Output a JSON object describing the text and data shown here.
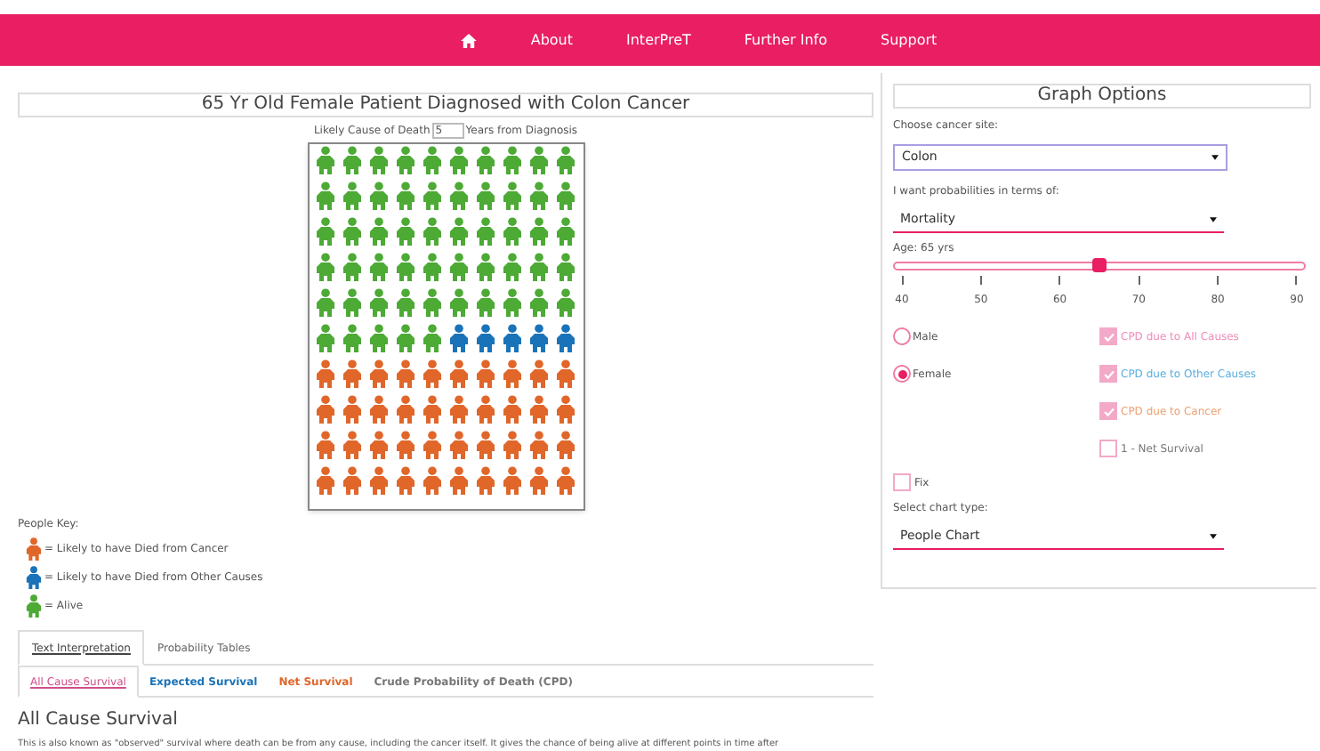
{
  "nav": {
    "items": [
      {
        "kind": "home"
      },
      {
        "label": "About"
      },
      {
        "label": "InterPreT"
      },
      {
        "label": "Further Info"
      },
      {
        "label": "Support"
      }
    ]
  },
  "title": "65 Yr Old Female Patient Diagnosed with Colon Cancer",
  "years_control": {
    "prefix": "Likely Cause of Death",
    "value": "5",
    "suffix": "Years from Diagnosis"
  },
  "people_chart": {
    "rows": [
      [
        {
          "kind": "alive"
        },
        {
          "kind": "alive"
        },
        {
          "kind": "alive"
        },
        {
          "kind": "alive"
        },
        {
          "kind": "alive"
        },
        {
          "kind": "alive"
        },
        {
          "kind": "alive"
        },
        {
          "kind": "alive"
        },
        {
          "kind": "alive"
        },
        {
          "kind": "alive"
        }
      ],
      [
        {
          "kind": "alive"
        },
        {
          "kind": "alive"
        },
        {
          "kind": "alive"
        },
        {
          "kind": "alive"
        },
        {
          "kind": "alive"
        },
        {
          "kind": "alive"
        },
        {
          "kind": "alive"
        },
        {
          "kind": "alive"
        },
        {
          "kind": "alive"
        },
        {
          "kind": "alive"
        }
      ],
      [
        {
          "kind": "alive"
        },
        {
          "kind": "alive"
        },
        {
          "kind": "alive"
        },
        {
          "kind": "alive"
        },
        {
          "kind": "alive"
        },
        {
          "kind": "alive"
        },
        {
          "kind": "alive"
        },
        {
          "kind": "alive"
        },
        {
          "kind": "alive"
        },
        {
          "kind": "alive"
        }
      ],
      [
        {
          "kind": "alive"
        },
        {
          "kind": "alive"
        },
        {
          "kind": "alive"
        },
        {
          "kind": "alive"
        },
        {
          "kind": "alive"
        },
        {
          "kind": "alive"
        },
        {
          "kind": "alive"
        },
        {
          "kind": "alive"
        },
        {
          "kind": "alive"
        },
        {
          "kind": "alive"
        }
      ],
      [
        {
          "kind": "alive"
        },
        {
          "kind": "alive"
        },
        {
          "kind": "alive"
        },
        {
          "kind": "alive"
        },
        {
          "kind": "alive"
        },
        {
          "kind": "alive"
        },
        {
          "kind": "alive"
        },
        {
          "kind": "alive"
        },
        {
          "kind": "alive"
        },
        {
          "kind": "alive"
        }
      ],
      [
        {
          "kind": "alive"
        },
        {
          "kind": "alive"
        },
        {
          "kind": "alive"
        },
        {
          "kind": "alive"
        },
        {
          "kind": "alive"
        },
        {
          "kind": "other"
        },
        {
          "kind": "other"
        },
        {
          "kind": "other"
        },
        {
          "kind": "other"
        },
        {
          "kind": "other"
        }
      ],
      [
        {
          "kind": "cancer"
        },
        {
          "kind": "cancer"
        },
        {
          "kind": "cancer"
        },
        {
          "kind": "cancer"
        },
        {
          "kind": "cancer"
        },
        {
          "kind": "cancer"
        },
        {
          "kind": "cancer"
        },
        {
          "kind": "cancer"
        },
        {
          "kind": "cancer"
        },
        {
          "kind": "cancer"
        }
      ],
      [
        {
          "kind": "cancer"
        },
        {
          "kind": "cancer"
        },
        {
          "kind": "cancer"
        },
        {
          "kind": "cancer"
        },
        {
          "kind": "cancer"
        },
        {
          "kind": "cancer"
        },
        {
          "kind": "cancer"
        },
        {
          "kind": "cancer"
        },
        {
          "kind": "cancer"
        },
        {
          "kind": "cancer"
        }
      ],
      [
        {
          "kind": "cancer"
        },
        {
          "kind": "cancer"
        },
        {
          "kind": "cancer"
        },
        {
          "kind": "cancer"
        },
        {
          "kind": "cancer"
        },
        {
          "kind": "cancer"
        },
        {
          "kind": "cancer"
        },
        {
          "kind": "cancer"
        },
        {
          "kind": "cancer"
        },
        {
          "kind": "cancer"
        }
      ],
      [
        {
          "kind": "cancer"
        },
        {
          "kind": "cancer"
        },
        {
          "kind": "cancer"
        },
        {
          "kind": "cancer"
        },
        {
          "kind": "cancer"
        },
        {
          "kind": "cancer"
        },
        {
          "kind": "cancer"
        },
        {
          "kind": "cancer"
        },
        {
          "kind": "cancer"
        },
        {
          "kind": "cancer"
        }
      ]
    ]
  },
  "key": {
    "title": "People Key:",
    "items": [
      {
        "kind": "cancer",
        "color": "#e0662a",
        "label": "= Likely to have Died from Cancer"
      },
      {
        "kind": "other",
        "color": "#1a73b8",
        "label": "= Likely to have Died from Other Causes"
      },
      {
        "kind": "alive",
        "color": "#4caa35",
        "label": "= Alive"
      }
    ]
  },
  "tabs": [
    {
      "label": "Text Interpretation",
      "selected": true
    },
    {
      "label": "Probability Tables",
      "selected": false
    }
  ],
  "subtabs": [
    {
      "label": "All Cause Survival",
      "selected": true,
      "color": "#d0508a"
    },
    {
      "label": "Expected Survival",
      "selected": false,
      "color": "#1a73b8"
    },
    {
      "label": "Net Survival",
      "selected": false,
      "color": "#e0662a"
    },
    {
      "label": "Crude Probability of Death (CPD)",
      "selected": false,
      "color": "#777777"
    }
  ],
  "section": {
    "heading": "All Cause Survival",
    "text": "This is also known as \"observed\" survival where death can be from any cause, including the cancer itself. It gives the chance of being alive at different points in time after"
  },
  "options": {
    "title": "Graph Options",
    "site": {
      "label": "Choose cancer site:",
      "value": "Colon"
    },
    "terms": {
      "label": "I want probabilities in terms of:",
      "value": "Mortality"
    },
    "age": {
      "label": "Age: 65 yrs",
      "level": 0.5,
      "ticks": [
        "40",
        "50",
        "60",
        "70",
        "80",
        "90"
      ]
    },
    "sex": [
      {
        "label": "Male",
        "selected": false
      },
      {
        "label": "Female",
        "selected": true
      }
    ],
    "curves": [
      {
        "label": "CPD due to All Causes",
        "checked": true,
        "color": "#f08cb8"
      },
      {
        "label": "CPD due to Other Causes",
        "checked": true,
        "color": "#5aaee0"
      },
      {
        "label": "CPD due to Cancer",
        "checked": true,
        "color": "#eea070"
      },
      {
        "label": "1 - Net Survival",
        "checked": false,
        "color": "#777777"
      }
    ],
    "fix": {
      "label": "Fix",
      "checked": false
    },
    "chart_type": {
      "label": "Select chart type:",
      "value": "People Chart"
    }
  }
}
